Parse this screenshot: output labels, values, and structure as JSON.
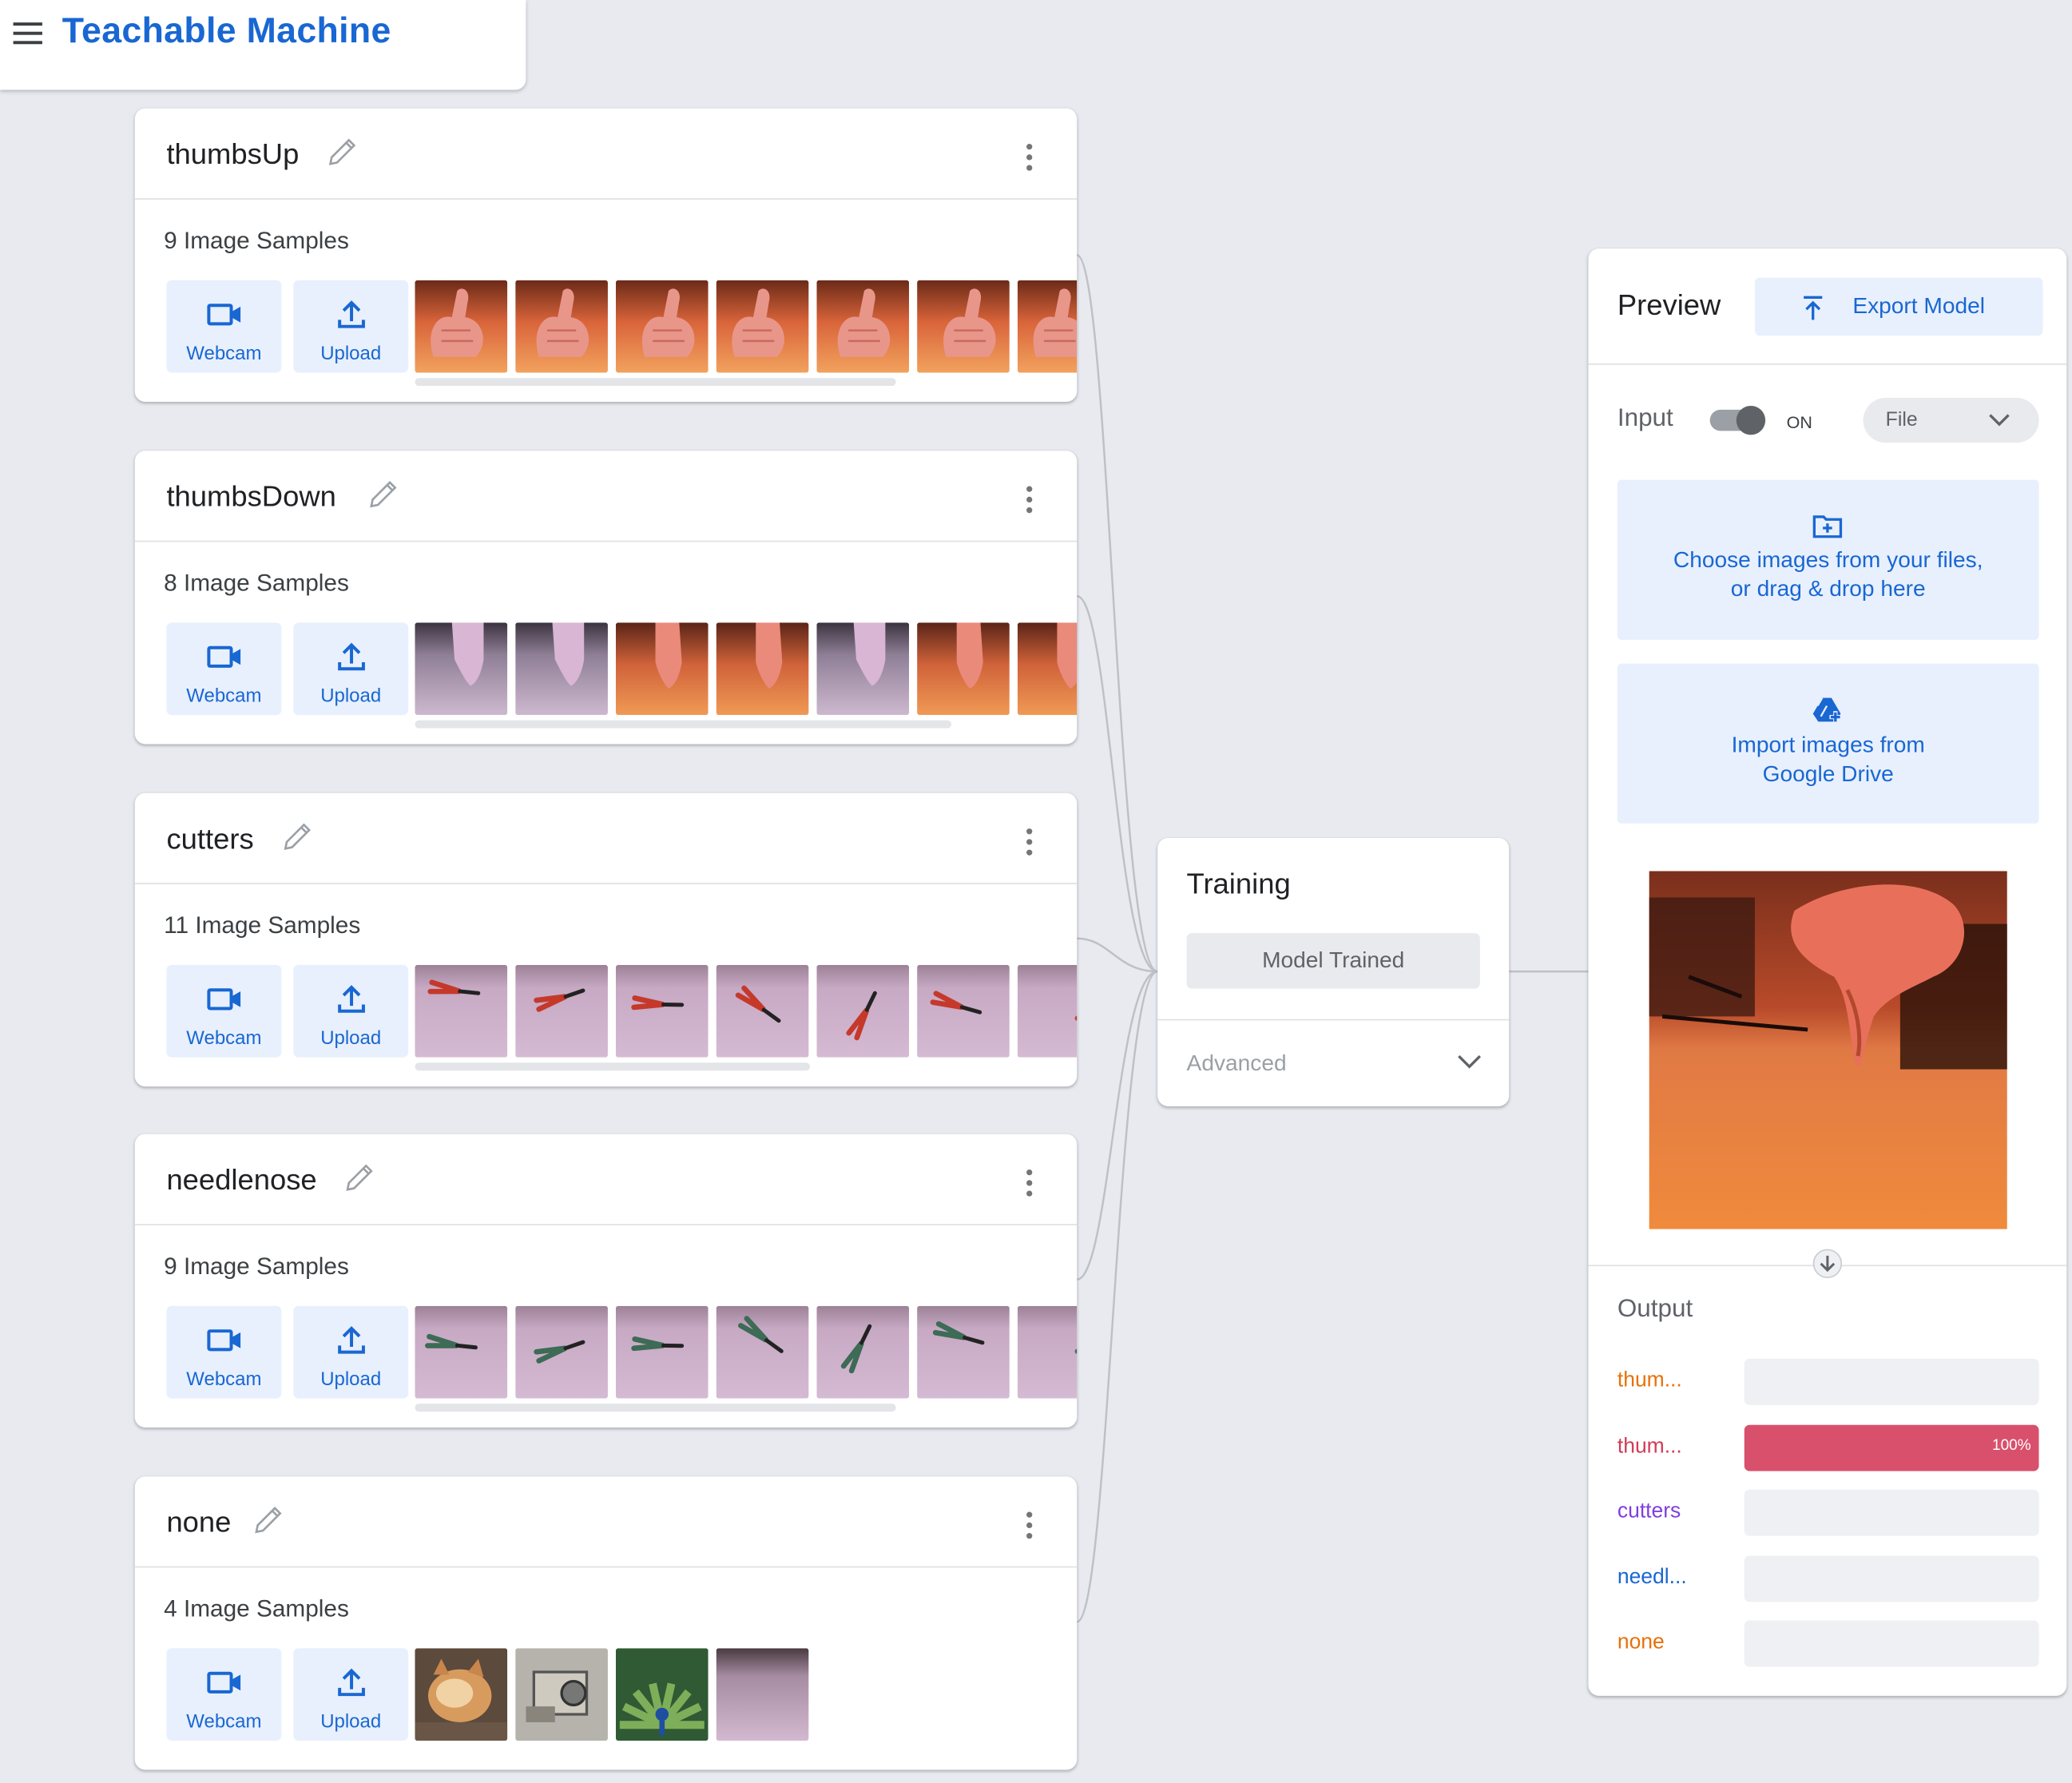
{
  "app": {
    "title": "Teachable Machine",
    "menu_icon": "hamburger-menu-icon"
  },
  "classes": [
    {
      "name": "thumbsUp",
      "samples_label": "9 Image Samples",
      "webcam_label": "Webcam",
      "upload_label": "Upload",
      "scroll_fraction": 0.51
    },
    {
      "name": "thumbsDown",
      "samples_label": "8 Image Samples",
      "webcam_label": "Webcam",
      "upload_label": "Upload",
      "scroll_fraction": 0.57
    },
    {
      "name": "cutters",
      "samples_label": "11 Image Samples",
      "webcam_label": "Webcam",
      "upload_label": "Upload",
      "scroll_fraction": 0.42
    },
    {
      "name": "needlenose",
      "samples_label": "9 Image Samples",
      "webcam_label": "Webcam",
      "upload_label": "Upload",
      "scroll_fraction": 0.51
    },
    {
      "name": "none",
      "samples_label": "4 Image Samples",
      "webcam_label": "Webcam",
      "upload_label": "Upload"
    }
  ],
  "training": {
    "title": "Training",
    "button_label": "Model Trained",
    "advanced_label": "Advanced"
  },
  "preview": {
    "title": "Preview",
    "export_label": "Export Model",
    "input_label": "Input",
    "toggle_state": "ON",
    "toggle_on": true,
    "input_source": "File",
    "file_drop_text_line1": "Choose images from your files,",
    "file_drop_text_line2": "or drag & drop here",
    "drive_text_line1": "Import images from",
    "drive_text_line2": "Google Drive",
    "output_label": "Output",
    "outputs": [
      {
        "label": "thum...",
        "color": "#e8710a",
        "value": 0
      },
      {
        "label": "thum...",
        "color": "#d33b58",
        "value": 1.0,
        "value_text": "100%"
      },
      {
        "label": "cutters",
        "color": "#7f3fe0",
        "value": 0
      },
      {
        "label": "needl...",
        "color": "#1967d2",
        "value": 0
      },
      {
        "label": "none",
        "color": "#e8710a",
        "value": 0
      }
    ]
  },
  "colors": {
    "accent": "#1967d2",
    "background": "#e8eaf0",
    "active_bar": "#d9506c"
  }
}
